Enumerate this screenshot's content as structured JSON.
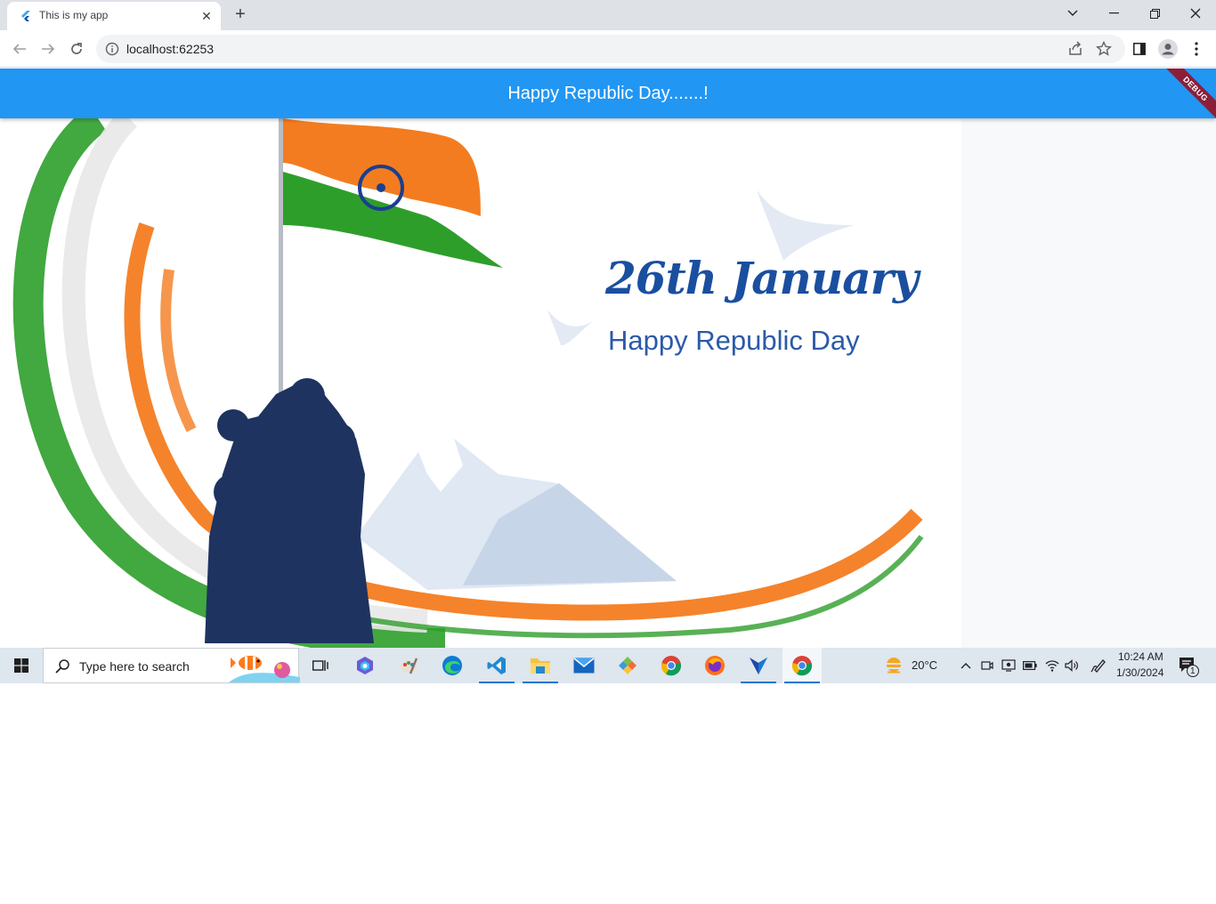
{
  "browser": {
    "tab_title": "This is my app",
    "tab_close": "✕",
    "new_tab": "+",
    "url": "localhost:62253"
  },
  "app": {
    "title": "Happy Republic Day.......!",
    "debug_banner": "DEBUG"
  },
  "hero": {
    "heading": "26th January",
    "subheading": "Happy Republic Day",
    "colors": {
      "saffron": "#f47c20",
      "green": "#2e9e2b",
      "navy": "#1e3360",
      "chakra": "#1a3f8f"
    }
  },
  "taskbar": {
    "search_placeholder": "Type here to search",
    "weather_temp": "20°C",
    "time": "10:24 AM",
    "date": "1/30/2024",
    "notification_count": "1",
    "apps": [
      "task-view",
      "copilot",
      "paint",
      "edge",
      "vscode",
      "file-explorer",
      "mail",
      "git",
      "chrome",
      "firefox",
      "vpn",
      "chrome-active"
    ]
  },
  "colors": {
    "appbar": "#2196f3",
    "tabstrip": "#dee1e6",
    "taskbar": "#dee6ee"
  }
}
